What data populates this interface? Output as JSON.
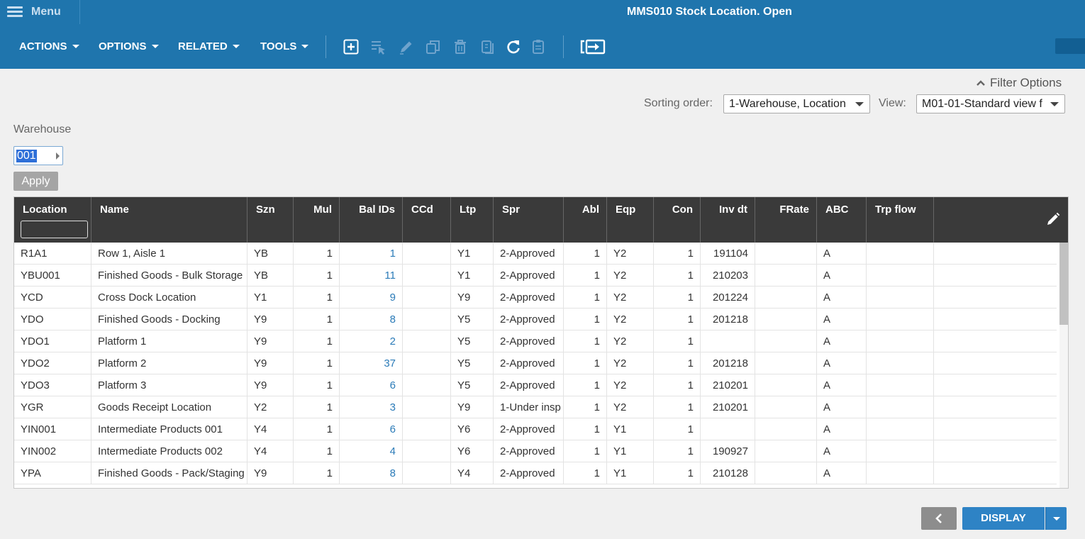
{
  "menu": {
    "label": "Menu"
  },
  "title": "MMS010 Stock Location. Open",
  "toolbar": {
    "menus": [
      "ACTIONS",
      "OPTIONS",
      "RELATED",
      "TOOLS"
    ],
    "icons": [
      "add-icon",
      "select-icon",
      "edit-icon",
      "copy-icon",
      "delete-icon",
      "duplicate-icon",
      "refresh-icon",
      "clipboard-icon",
      "display-panel-icon"
    ]
  },
  "filter": {
    "options_label": "Filter Options",
    "sorting_label": "Sorting order:",
    "sorting_value": "1-Warehouse, Location",
    "view_label": "View:",
    "view_value": "M01-01-Standard view f",
    "warehouse_label": "Warehouse",
    "warehouse_value": "001",
    "apply_label": "Apply"
  },
  "grid": {
    "columns": [
      "Location",
      "Name",
      "Szn",
      "Mul",
      "Bal IDs",
      "CCd",
      "Ltp",
      "Spr",
      "Abl",
      "Eqp",
      "Con",
      "Inv dt",
      "FRate",
      "ABC",
      "Trp flow"
    ],
    "rows": [
      [
        "R1A1",
        "Row 1, Aisle 1",
        "YB",
        "1",
        "1",
        "",
        "Y1",
        "2-Approved",
        "1",
        "Y2",
        "1",
        "191104",
        "",
        "A",
        ""
      ],
      [
        "YBU001",
        "Finished Goods - Bulk Storage",
        "YB",
        "1",
        "11",
        "",
        "Y1",
        "2-Approved",
        "1",
        "Y2",
        "1",
        "210203",
        "",
        "A",
        ""
      ],
      [
        "YCD",
        "Cross Dock Location",
        "Y1",
        "1",
        "9",
        "",
        "Y9",
        "2-Approved",
        "1",
        "Y2",
        "1",
        "201224",
        "",
        "A",
        ""
      ],
      [
        "YDO",
        "Finished Goods - Docking",
        "Y9",
        "1",
        "8",
        "",
        "Y5",
        "2-Approved",
        "1",
        "Y2",
        "1",
        "201218",
        "",
        "A",
        ""
      ],
      [
        "YDO1",
        "Platform 1",
        "Y9",
        "1",
        "2",
        "",
        "Y5",
        "2-Approved",
        "1",
        "Y2",
        "1",
        "",
        "",
        "A",
        ""
      ],
      [
        "YDO2",
        "Platform 2",
        "Y9",
        "1",
        "37",
        "",
        "Y5",
        "2-Approved",
        "1",
        "Y2",
        "1",
        "201218",
        "",
        "A",
        ""
      ],
      [
        "YDO3",
        "Platform 3",
        "Y9",
        "1",
        "6",
        "",
        "Y5",
        "2-Approved",
        "1",
        "Y2",
        "1",
        "210201",
        "",
        "A",
        ""
      ],
      [
        "YGR",
        "Goods Receipt Location",
        "Y2",
        "1",
        "3",
        "",
        "Y9",
        "1-Under insp",
        "1",
        "Y2",
        "1",
        "210201",
        "",
        "A",
        ""
      ],
      [
        "YIN001",
        "Intermediate Products 001",
        "Y4",
        "1",
        "6",
        "",
        "Y6",
        "2-Approved",
        "1",
        "Y1",
        "1",
        "",
        "",
        "A",
        ""
      ],
      [
        "YIN002",
        "Intermediate Products 002",
        "Y4",
        "1",
        "4",
        "",
        "Y6",
        "2-Approved",
        "1",
        "Y1",
        "1",
        "190927",
        "",
        "A",
        ""
      ],
      [
        "YPA",
        "Finished Goods - Pack/Staging",
        "Y9",
        "1",
        "8",
        "",
        "Y4",
        "2-Approved",
        "1",
        "Y1",
        "1",
        "210128",
        "",
        "A",
        ""
      ]
    ]
  },
  "footer": {
    "display_label": "DISPLAY"
  },
  "colors": {
    "header_blue": "#1f75ad",
    "grid_header": "#3a3a3a",
    "link": "#2b7bb8",
    "display_button": "#2e83c5"
  }
}
